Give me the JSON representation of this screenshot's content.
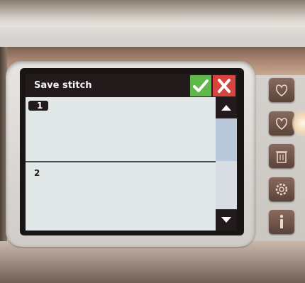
{
  "dialog": {
    "title": "Save stitch",
    "confirm_icon": "check-icon",
    "cancel_icon": "close-icon"
  },
  "slots": [
    {
      "number": "1",
      "selected": true
    },
    {
      "number": "2",
      "selected": false
    }
  ],
  "scrollbar": {
    "up_icon": "triangle-up-icon",
    "down_icon": "triangle-down-icon"
  },
  "side_buttons": [
    "heart-icon",
    "heart-save-icon",
    "trash-icon",
    "gear-icon",
    "info-icon"
  ],
  "colors": {
    "titlebar": "#231a1c",
    "confirm": "#5fb84a",
    "cancel": "#d8453e",
    "screen": "#e4e9e8"
  }
}
